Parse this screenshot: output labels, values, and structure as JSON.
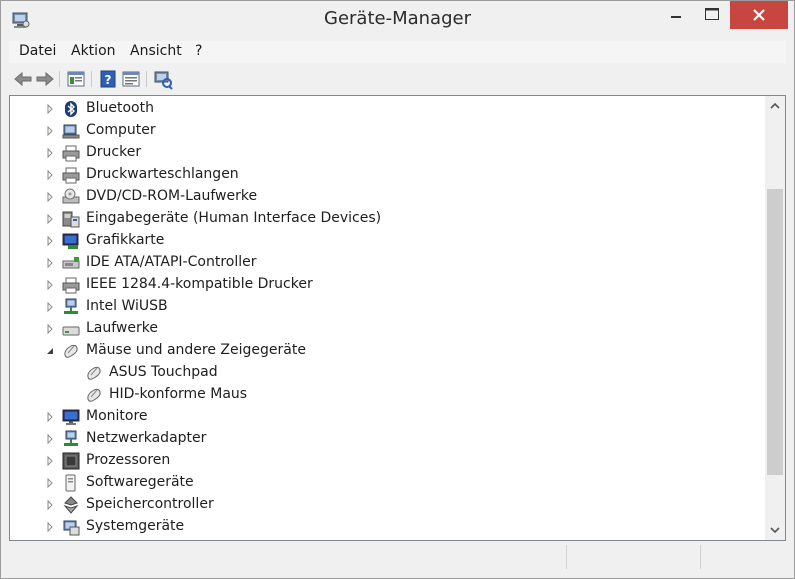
{
  "window": {
    "title": "Geräte-Manager",
    "app_icon": "device-manager-icon"
  },
  "menubar": {
    "items": [
      "Datei",
      "Aktion",
      "Ansicht",
      "?"
    ]
  },
  "toolbar": {
    "buttons": [
      "back-arrow-icon",
      "forward-arrow-icon",
      "properties-icon",
      "help-icon",
      "view-icon",
      "scan-hardware-icon"
    ]
  },
  "tree": {
    "items": [
      {
        "label": "Bluetooth",
        "icon": "bluetooth-icon",
        "level": 0,
        "expanded": false
      },
      {
        "label": "Computer",
        "icon": "computer-icon",
        "level": 0,
        "expanded": false
      },
      {
        "label": "Drucker",
        "icon": "printer-icon",
        "level": 0,
        "expanded": false
      },
      {
        "label": "Druckwarteschlangen",
        "icon": "printer-icon",
        "level": 0,
        "expanded": false
      },
      {
        "label": "DVD/CD-ROM-Laufwerke",
        "icon": "dvd-drive-icon",
        "level": 0,
        "expanded": false
      },
      {
        "label": "Eingabegeräte (Human Interface Devices)",
        "icon": "hid-icon",
        "level": 0,
        "expanded": false
      },
      {
        "label": "Grafikkarte",
        "icon": "display-adapter-icon",
        "level": 0,
        "expanded": false
      },
      {
        "label": "IDE ATA/ATAPI-Controller",
        "icon": "ide-controller-icon",
        "level": 0,
        "expanded": false
      },
      {
        "label": "IEEE 1284.4-kompatible Drucker",
        "icon": "printer-icon",
        "level": 0,
        "expanded": false
      },
      {
        "label": "Intel WiUSB",
        "icon": "network-icon",
        "level": 0,
        "expanded": false
      },
      {
        "label": "Laufwerke",
        "icon": "disk-drive-icon",
        "level": 0,
        "expanded": false
      },
      {
        "label": "Mäuse und andere Zeigegeräte",
        "icon": "mouse-icon",
        "level": 0,
        "expanded": true
      },
      {
        "label": "ASUS Touchpad",
        "icon": "mouse-icon",
        "level": 1,
        "expanded": null
      },
      {
        "label": "HID-konforme Maus",
        "icon": "mouse-icon",
        "level": 1,
        "expanded": null
      },
      {
        "label": "Monitore",
        "icon": "monitor-icon",
        "level": 0,
        "expanded": false
      },
      {
        "label": "Netzwerkadapter",
        "icon": "network-icon",
        "level": 0,
        "expanded": false
      },
      {
        "label": "Prozessoren",
        "icon": "processor-icon",
        "level": 0,
        "expanded": false
      },
      {
        "label": "Softwaregeräte",
        "icon": "software-device-icon",
        "level": 0,
        "expanded": false
      },
      {
        "label": "Speichercontroller",
        "icon": "storage-controller-icon",
        "level": 0,
        "expanded": false
      },
      {
        "label": "Systemgeräte",
        "icon": "system-device-icon",
        "level": 0,
        "expanded": false
      }
    ]
  },
  "colors": {
    "close_button": "#c7463f",
    "tree_background": "#ffffff",
    "window_frame": "#f0f0f0"
  }
}
